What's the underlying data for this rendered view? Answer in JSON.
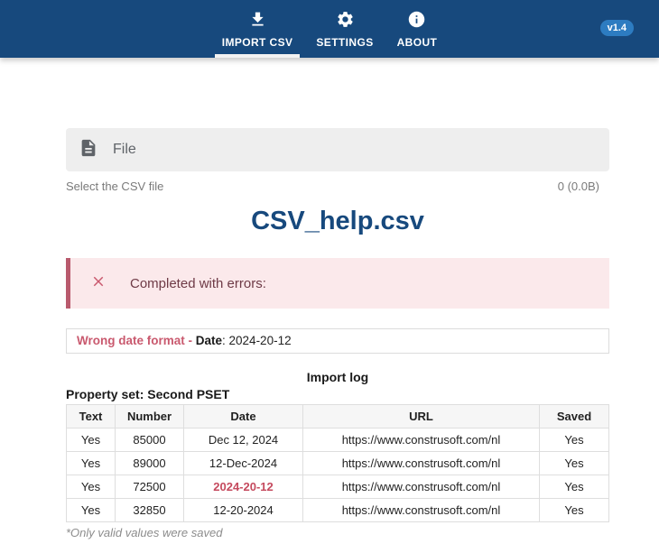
{
  "header": {
    "nav": [
      {
        "label": "IMPORT CSV",
        "icon": "download-icon",
        "active": true
      },
      {
        "label": "SETTINGS",
        "icon": "gear-icon",
        "active": false
      },
      {
        "label": "ABOUT",
        "icon": "info-icon",
        "active": false
      }
    ],
    "version_badge": "v1.4"
  },
  "file_section": {
    "title": "File",
    "hint": "Select the CSV file",
    "size": "0 (0.0B)"
  },
  "filename": "CSV_help.csv",
  "alert": {
    "message": "Completed with errors:"
  },
  "error_detail": {
    "kind": "Wrong date format - ",
    "field": "Date",
    "value": ": 2024-20-12"
  },
  "import_log": {
    "title": "Import log",
    "property_set": "Property set: Second PSET",
    "columns": [
      "Text",
      "Number",
      "Date",
      "URL",
      "Saved"
    ],
    "rows": [
      {
        "text": "Yes",
        "number": "85000",
        "date": "Dec 12, 2024",
        "url": "https://www.construsoft.com/nl",
        "saved": "Yes"
      },
      {
        "text": "Yes",
        "number": "89000",
        "date": "12-Dec-2024",
        "url": "https://www.construsoft.com/nl",
        "saved": "Yes"
      },
      {
        "text": "Yes",
        "number": "72500",
        "date": "2024-20-12",
        "url": "https://www.construsoft.com/nl",
        "saved": "Yes"
      },
      {
        "text": "Yes",
        "number": "32850",
        "date": "12-20-2024",
        "url": "https://www.construsoft.com/nl",
        "saved": "Yes"
      }
    ],
    "footnote": "*Only valid values were saved"
  },
  "colors": {
    "header_navy": "#17497d",
    "badge_blue": "#2d7cc1",
    "alert_background": "#fbe9eb",
    "alert_border": "#b95a6d",
    "alert_text": "#6e3a46",
    "error_rose": "#c9596e",
    "invalid_date_red": "#c54a5e",
    "panel_gray": "#eeeeee"
  }
}
